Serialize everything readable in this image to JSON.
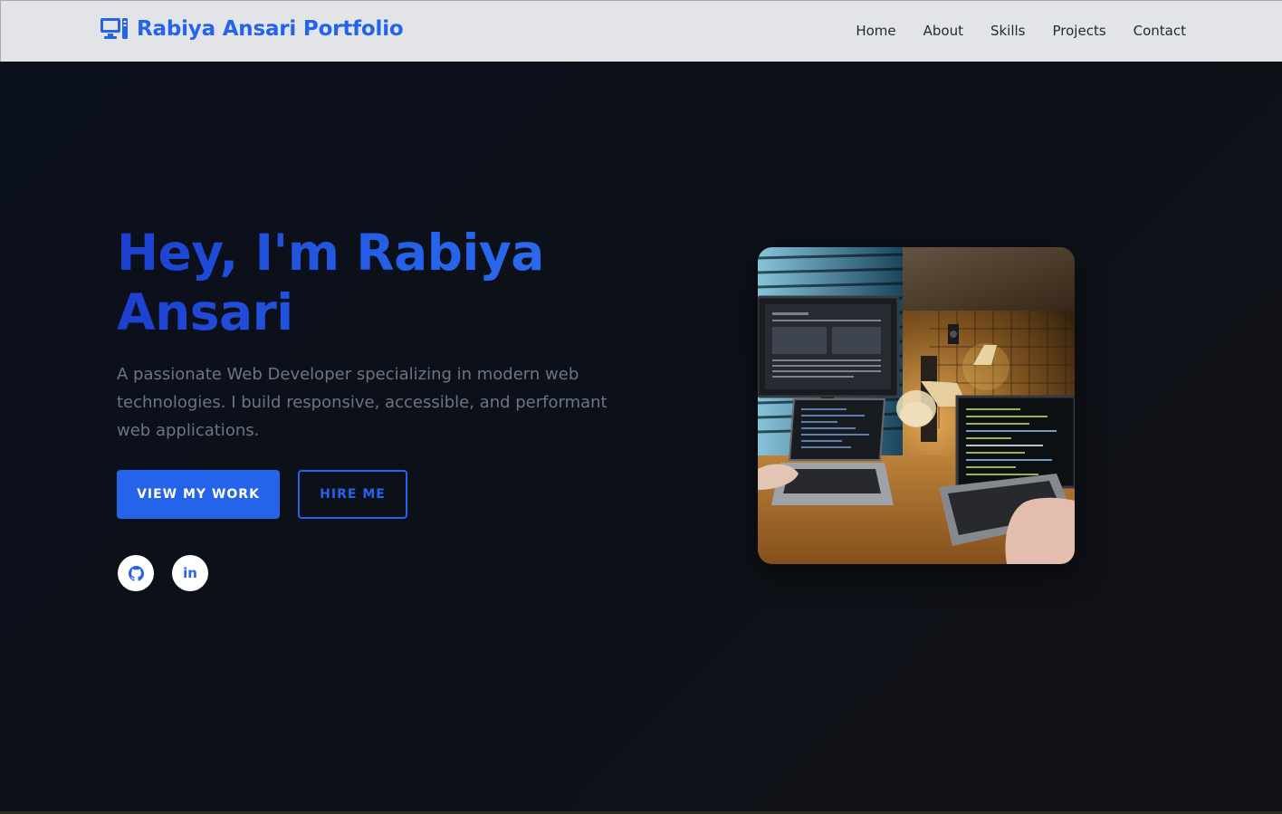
{
  "brand": {
    "icon": "desktop-computer-icon",
    "name": "Rabiya Ansari Portfolio"
  },
  "nav": {
    "items": [
      {
        "label": "Home"
      },
      {
        "label": "About"
      },
      {
        "label": "Skills"
      },
      {
        "label": "Projects"
      },
      {
        "label": "Contact"
      }
    ]
  },
  "hero": {
    "title": "Hey, I'm Rabiya Ansari",
    "description": "A passionate Web Developer specializing in modern web technologies. I build responsive, accessible, and performant web applications.",
    "primary_button": "VIEW MY WORK",
    "secondary_button": "HIRE ME",
    "social": [
      {
        "icon": "github-icon"
      },
      {
        "icon": "linkedin-icon",
        "glyph": "in"
      }
    ],
    "image": {
      "subject": "developer-workspace-photo"
    }
  },
  "colors": {
    "accent": "#2563eb",
    "navbar_bg": "#e2e4e8",
    "hero_bg": "#0b0d12",
    "text_muted": "#6b7588",
    "nav_text": "#1f2937"
  }
}
